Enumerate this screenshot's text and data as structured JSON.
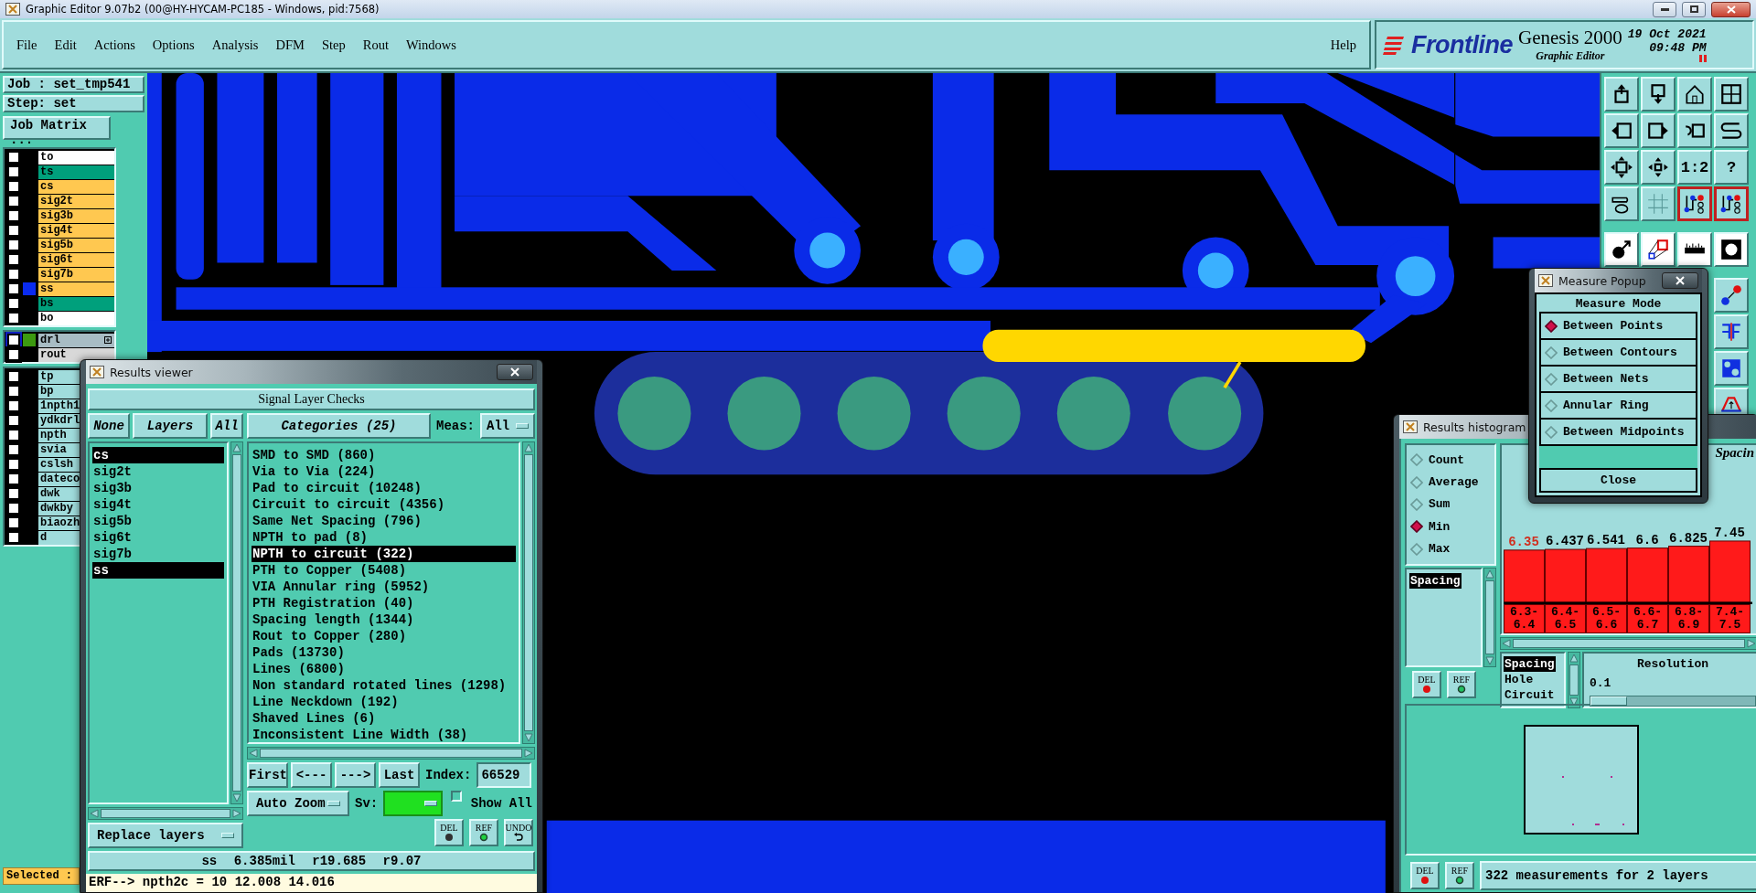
{
  "window": {
    "title": "Graphic Editor 9.07b2 (00@HY-HYCAM-PC185 - Windows, pid:7568)"
  },
  "menu": {
    "items": [
      "File",
      "Edit",
      "Actions",
      "Options",
      "Analysis",
      "DFM",
      "Step",
      "Rout",
      "Windows"
    ],
    "help": "Help"
  },
  "brand": {
    "logo": "Frontline",
    "product": "Genesis 2000",
    "subtitle": "Graphic Editor",
    "date": "19 Oct 2021",
    "time": "09:48 PM"
  },
  "job": {
    "job": "Job : set_tmp541",
    "step": "Step: set",
    "matrix_button": "Job Matrix ..."
  },
  "layer_groups": [
    {
      "layers": [
        {
          "name": "to",
          "color": "#ffffff",
          "checked": false
        },
        {
          "name": "ts",
          "color": "#00a07c",
          "checked": false
        },
        {
          "name": "cs",
          "color": "#ffc850",
          "checked": false
        },
        {
          "name": "sig2t",
          "color": "#ffc850",
          "checked": false
        },
        {
          "name": "sig3b",
          "color": "#ffc850",
          "checked": false
        },
        {
          "name": "sig4t",
          "color": "#ffc850",
          "checked": false
        },
        {
          "name": "sig5b",
          "color": "#ffc850",
          "checked": false
        },
        {
          "name": "sig6t",
          "color": "#ffc850",
          "checked": false
        },
        {
          "name": "sig7b",
          "color": "#ffc850",
          "checked": false
        },
        {
          "name": "ss",
          "color": "#ffc850",
          "swatch": {
            "color": "#0a2bf0"
          },
          "checked": false
        },
        {
          "name": "bs",
          "color": "#00a07c",
          "checked": false
        },
        {
          "name": "bo",
          "color": "#ffffff",
          "checked": false
        }
      ]
    },
    {
      "layers": [
        {
          "name": "drl",
          "color": "#a8bcc4",
          "swatch": {
            "color": "#3c9a10"
          },
          "checked": false,
          "highlighted": true,
          "expandable": true
        },
        {
          "name": "rout",
          "color": "#d8d8d8",
          "checked": false,
          "highlighted": false,
          "expandable": false
        }
      ]
    },
    {
      "layers": [
        {
          "name": "tp",
          "color": "#a0dcdc",
          "checked": false
        },
        {
          "name": "bp",
          "color": "#a0dcdc",
          "checked": false
        },
        {
          "name": "1npth1",
          "color": "#a0dcdc",
          "checked": false
        },
        {
          "name": "ydkdrl",
          "color": "#a0dcdc",
          "checked": false
        },
        {
          "name": "npth",
          "color": "#a0dcdc",
          "checked": false
        },
        {
          "name": "svia",
          "color": "#a0dcdc",
          "checked": false
        },
        {
          "name": "cslsh",
          "color": "#a0dcdc",
          "checked": false
        },
        {
          "name": "dateco",
          "color": "#a0dcdc",
          "checked": false
        },
        {
          "name": "dwk",
          "color": "#a0dcdc",
          "checked": false
        },
        {
          "name": "dwkby",
          "color": "#a0dcdc",
          "checked": false
        },
        {
          "name": "biaozh",
          "color": "#a0dcdc",
          "checked": false
        },
        {
          "name": "d",
          "color": "#a0dcdc",
          "checked": false
        }
      ]
    }
  ],
  "selected_label": "Selected :",
  "toolbar": {
    "groups": [
      {
        "buttons": [
          {
            "kind": "upload",
            "highlighted": false
          },
          {
            "kind": "download",
            "highlighted": false
          },
          {
            "kind": "home",
            "highlighted": false
          },
          {
            "kind": "grid-window",
            "highlighted": false
          },
          {
            "kind": "arrow-left",
            "highlighted": false
          },
          {
            "kind": "arrow-right",
            "highlighted": false
          },
          {
            "kind": "undo",
            "highlighted": false
          },
          {
            "kind": "s-curve",
            "highlighted": false
          },
          {
            "kind": "expand",
            "highlighted": false
          },
          {
            "kind": "move",
            "highlighted": false
          },
          {
            "kind": "ratio",
            "label": "1:2",
            "highlighted": false
          },
          {
            "kind": "help",
            "label": "?",
            "highlighted": false
          },
          {
            "kind": "wrench",
            "highlighted": false
          },
          {
            "kind": "grid",
            "highlighted": false
          },
          {
            "kind": "circuit",
            "highlighted": true
          },
          {
            "kind": "circuit",
            "highlighted": true
          }
        ]
      },
      {
        "buttons": [
          {
            "kind": "ball-arrow",
            "highlighted": false
          },
          {
            "kind": "shapes",
            "highlighted": false
          },
          {
            "kind": "ruler",
            "highlighted": false
          },
          {
            "kind": "square-ring",
            "highlighted": false
          }
        ]
      },
      {
        "buttons": [
          {
            "kind": "dots-link",
            "highlighted": false
          },
          {
            "kind": "mirror-f",
            "highlighted": false
          },
          {
            "kind": "blue-shapes",
            "highlighted": false
          },
          {
            "kind": "arch",
            "highlighted": false
          }
        ]
      }
    ]
  },
  "results_viewer": {
    "title": "Results viewer",
    "heading": "Signal Layer Checks",
    "layer_buttons": [
      "None",
      "Layers",
      "All"
    ],
    "layers": [
      {
        "name": "cs",
        "selected": true
      },
      {
        "name": "sig2t",
        "selected": false
      },
      {
        "name": "sig3b",
        "selected": false
      },
      {
        "name": "sig4t",
        "selected": false
      },
      {
        "name": "sig5b",
        "selected": false
      },
      {
        "name": "sig6t",
        "selected": false
      },
      {
        "name": "sig7b",
        "selected": false
      },
      {
        "name": "ss",
        "selected": true
      }
    ],
    "replace_menu": "Replace layers",
    "categories_button": "Categories (25)",
    "meas_label": "Meas:",
    "meas_value": "All",
    "categories": [
      {
        "name": "SMD to SMD (860)",
        "selected": false
      },
      {
        "name": "Via to Via (224)",
        "selected": false
      },
      {
        "name": "Pad to circuit (10248)",
        "selected": false
      },
      {
        "name": "Circuit to circuit (4356)",
        "selected": false
      },
      {
        "name": "Same Net Spacing (796)",
        "selected": false
      },
      {
        "name": "NPTH to pad (8)",
        "selected": false
      },
      {
        "name": "NPTH to circuit (322)",
        "selected": true
      },
      {
        "name": "PTH to Copper (5408)",
        "selected": false
      },
      {
        "name": "VIA Annular ring (5952)",
        "selected": false
      },
      {
        "name": "PTH Registration (40)",
        "selected": false
      },
      {
        "name": "Spacing length (1344)",
        "selected": false
      },
      {
        "name": "Rout to Copper (280)",
        "selected": false
      },
      {
        "name": "Pads (13730)",
        "selected": false
      },
      {
        "name": "Lines (6800)",
        "selected": false
      },
      {
        "name": "Non standard rotated lines (1298)",
        "selected": false
      },
      {
        "name": "Line Neckdown (192)",
        "selected": false
      },
      {
        "name": "Shaved Lines (6)",
        "selected": false
      },
      {
        "name": "Inconsistent Line Width (38)",
        "selected": false
      }
    ],
    "nav_buttons": [
      "First",
      "<---",
      "--->",
      "Last"
    ],
    "index_label": "Index:",
    "index_value": "66529",
    "zoom_menu": "Auto Zoom",
    "sv_label": "Sv:",
    "show_all": {
      "label": "Show All",
      "checked": false
    },
    "actions": [
      {
        "kind": "delete",
        "label": "DEL",
        "color": "#303030"
      },
      {
        "kind": "reference",
        "label": "REF",
        "color": "#20d040"
      },
      {
        "kind": "undo",
        "label": "UNDO"
      }
    ],
    "status": "ss 6.385mil r19.685 r9.07",
    "erf": "ERF--> npth2c = 10 12.008 14.016"
  },
  "measure_popup": {
    "title": "Measure Popup",
    "heading": "Measure Mode",
    "modes": [
      {
        "label": "Between Points",
        "selected": true
      },
      {
        "label": "Between Contours",
        "selected": false
      },
      {
        "label": "Between Nets",
        "selected": false
      },
      {
        "label": "Annular Ring",
        "selected": false
      },
      {
        "label": "Between Midpoints",
        "selected": false
      }
    ],
    "close": "Close"
  },
  "histogram": {
    "title": "Results histogram",
    "stats": [
      {
        "label": "Count",
        "selected": false
      },
      {
        "label": "Average",
        "selected": false
      },
      {
        "label": "Sum",
        "selected": false
      },
      {
        "label": "Min",
        "selected": true
      },
      {
        "label": "Max",
        "selected": false
      }
    ],
    "results": [
      {
        "label": "Spacing",
        "selected": true
      }
    ],
    "list_buttons": [
      {
        "kind": "delete",
        "label": "DEL",
        "color": "#e01010"
      },
      {
        "kind": "reference",
        "label": "REF",
        "color": "#20c060"
      }
    ],
    "chart_data": {
      "type": "bar",
      "title": "Spacin",
      "categories": [
        "6.3-6.4",
        "6.4-6.5",
        "6.5-6.6",
        "6.6-6.7",
        "6.8-6.9",
        "7.4-7.5"
      ],
      "values": [
        6.35,
        6.437,
        6.541,
        6.6,
        6.825,
        7.45
      ],
      "data_labels": true
    },
    "types": [
      {
        "label": "Spacing",
        "selected": true
      },
      {
        "label": "Hole",
        "selected": false
      },
      {
        "label": "Circuit",
        "selected": false
      }
    ],
    "resolution": {
      "label": "Resolution",
      "value": "0.1",
      "level": 0
    },
    "footer_buttons": [
      {
        "kind": "delete",
        "label": "DEL",
        "color": "#e01010"
      },
      {
        "kind": "reference",
        "label": "REF",
        "color": "#20c060"
      }
    ],
    "summary": "322 measurements for 2 layers"
  }
}
